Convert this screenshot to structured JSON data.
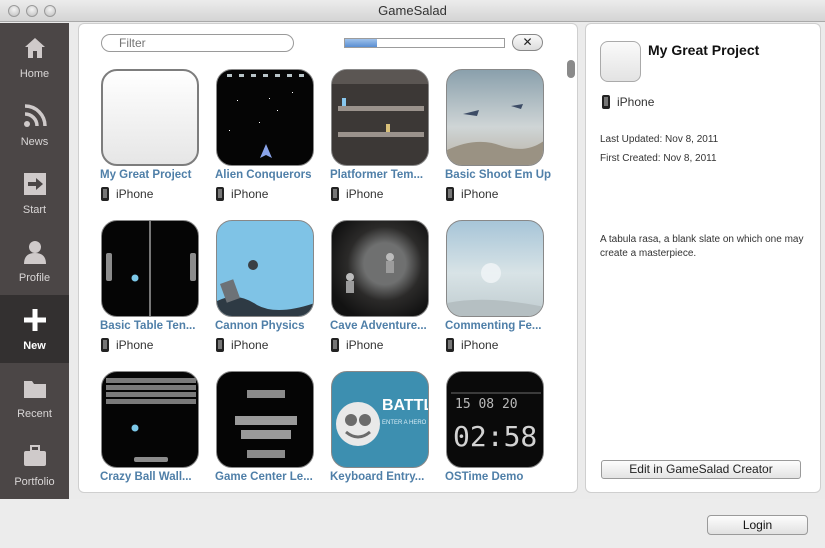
{
  "window": {
    "title": "GameSalad"
  },
  "sidebar": {
    "items": [
      {
        "label": "Home",
        "icon": "home-icon"
      },
      {
        "label": "News",
        "icon": "rss-icon"
      },
      {
        "label": "Start",
        "icon": "start-arrow-icon"
      },
      {
        "label": "Profile",
        "icon": "profile-icon"
      },
      {
        "label": "New",
        "icon": "plus-icon",
        "active": true
      },
      {
        "label": "Recent",
        "icon": "folder-icon"
      },
      {
        "label": "Portfolio",
        "icon": "briefcase-icon"
      }
    ]
  },
  "toolbar": {
    "filter_placeholder": "Filter",
    "progress_fraction": 0.2,
    "clear_label": "✕"
  },
  "templates": [
    {
      "name": "My Great Project",
      "platform": "iPhone"
    },
    {
      "name": "Alien Conquerors",
      "platform": "iPhone"
    },
    {
      "name": "Platformer Tem...",
      "platform": "iPhone"
    },
    {
      "name": "Basic Shoot Em Up",
      "platform": "iPhone"
    },
    {
      "name": "Basic Table Ten...",
      "platform": "iPhone"
    },
    {
      "name": "Cannon Physics",
      "platform": "iPhone"
    },
    {
      "name": "Cave Adventure...",
      "platform": "iPhone"
    },
    {
      "name": "Commenting Fe...",
      "platform": "iPhone"
    },
    {
      "name": "Crazy Ball Wall...",
      "platform": ""
    },
    {
      "name": "Game Center Le...",
      "platform": ""
    },
    {
      "name": "Keyboard Entry...",
      "platform": ""
    },
    {
      "name": "OSTime Demo",
      "platform": ""
    }
  ],
  "thumb_text": {
    "battle": "BATTL",
    "enter_hero": "ENTER A HERO",
    "clock_top": "15 08 20",
    "clock_big": "02:58"
  },
  "detail": {
    "title": "My Great Project",
    "platform": "iPhone",
    "last_updated": "Last Updated: Nov 8, 2011",
    "first_created": "First Created: Nov 8, 2011",
    "description": "A tabula rasa, a blank slate on which one may create a masterpiece.",
    "edit_button": "Edit in GameSalad Creator"
  },
  "footer": {
    "login_label": "Login"
  }
}
